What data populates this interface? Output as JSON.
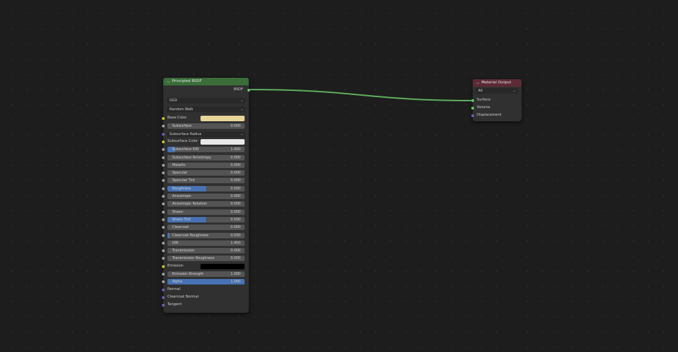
{
  "colors": {
    "socket_color": "#c7c729",
    "socket_float": "#a1a1a1",
    "socket_vector": "#6363c7",
    "socket_shader": "#63c763",
    "bsdf_header": "#3a6d3a",
    "output_header": "#5c2a35",
    "link": "#5fb15f",
    "slider_fill": "#4772b3"
  },
  "principled": {
    "title": "Principled BSDF",
    "output_label": "BSDF",
    "distribution": "GGX",
    "subsurface_method": "Random Walk",
    "rows": [
      {
        "kind": "color",
        "label": "Base Color",
        "swatch": "#e8d59a",
        "socket": "color"
      },
      {
        "kind": "slider",
        "label": "Subsurface",
        "value": "0.000",
        "fill": 0,
        "socket": "float"
      },
      {
        "kind": "dropdown",
        "label": "Subsurface Radius",
        "socket": "vector"
      },
      {
        "kind": "color",
        "label": "Subsurface Color",
        "swatch": "#e8e8e8",
        "socket": "color"
      },
      {
        "kind": "slider",
        "label": "Subsurface IOR",
        "value": "1.400",
        "fill": 0.1,
        "socket": "float"
      },
      {
        "kind": "slider",
        "label": "Subsurface Anisotropy",
        "value": "0.000",
        "fill": 0,
        "socket": "float"
      },
      {
        "kind": "slider",
        "label": "Metallic",
        "value": "0.000",
        "fill": 0,
        "socket": "float"
      },
      {
        "kind": "slider",
        "label": "Specular",
        "value": "0.000",
        "fill": 0,
        "socket": "float"
      },
      {
        "kind": "slider",
        "label": "Specular Tint",
        "value": "0.000",
        "fill": 0,
        "socket": "float"
      },
      {
        "kind": "slider",
        "label": "Roughness",
        "value": "0.500",
        "fill": 0.5,
        "socket": "float"
      },
      {
        "kind": "slider",
        "label": "Anisotropic",
        "value": "0.000",
        "fill": 0,
        "socket": "float"
      },
      {
        "kind": "slider",
        "label": "Anisotropic Rotation",
        "value": "0.000",
        "fill": 0,
        "socket": "float"
      },
      {
        "kind": "slider",
        "label": "Sheen",
        "value": "0.000",
        "fill": 0,
        "socket": "float"
      },
      {
        "kind": "slider",
        "label": "Sheen Tint",
        "value": "0.500",
        "fill": 0.5,
        "socket": "float"
      },
      {
        "kind": "slider",
        "label": "Clearcoat",
        "value": "0.000",
        "fill": 0,
        "socket": "float"
      },
      {
        "kind": "slider",
        "label": "Clearcoat Roughness",
        "value": "0.030",
        "fill": 0.03,
        "socket": "float"
      },
      {
        "kind": "slider",
        "label": "IOR",
        "value": "1.450",
        "fill": 0,
        "socket": "float"
      },
      {
        "kind": "slider",
        "label": "Transmission",
        "value": "0.000",
        "fill": 0,
        "socket": "float"
      },
      {
        "kind": "slider",
        "label": "Transmission Roughness",
        "value": "0.000",
        "fill": 0,
        "socket": "float"
      },
      {
        "kind": "color",
        "label": "Emission",
        "swatch": "#000000",
        "socket": "color"
      },
      {
        "kind": "slider",
        "label": "Emission Strength",
        "value": "1.000",
        "fill": 0,
        "socket": "float"
      },
      {
        "kind": "slider",
        "label": "Alpha",
        "value": "1.000",
        "fill": 1,
        "socket": "float"
      },
      {
        "kind": "plain",
        "label": "Normal",
        "socket": "vector"
      },
      {
        "kind": "plain",
        "label": "Clearcoat Normal",
        "socket": "vector"
      },
      {
        "kind": "plain",
        "label": "Tangent",
        "socket": "vector"
      }
    ]
  },
  "material_output": {
    "title": "Material Output",
    "target": "All",
    "inputs": [
      {
        "label": "Surface",
        "socket": "shader"
      },
      {
        "label": "Volume",
        "socket": "shader"
      },
      {
        "label": "Displacement",
        "socket": "vector"
      }
    ]
  }
}
